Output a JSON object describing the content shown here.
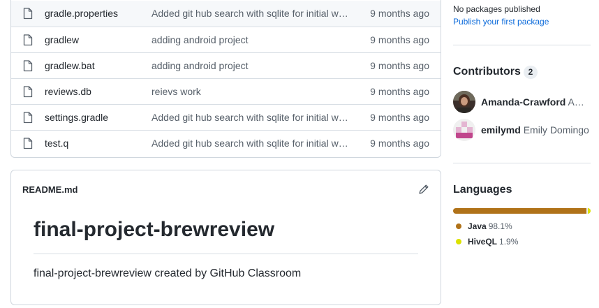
{
  "files": [
    {
      "name": "gradle.properties",
      "message": "Added git hub search with sqlite for initial work",
      "age": "9 months ago"
    },
    {
      "name": "gradlew",
      "message": "adding android project",
      "age": "9 months ago"
    },
    {
      "name": "gradlew.bat",
      "message": "adding android project",
      "age": "9 months ago"
    },
    {
      "name": "reviews.db",
      "message": "reievs work",
      "age": "9 months ago"
    },
    {
      "name": "settings.gradle",
      "message": "Added git hub search with sqlite for initial work",
      "age": "9 months ago"
    },
    {
      "name": "test.q",
      "message": "Added git hub search with sqlite for initial work",
      "age": "9 months ago"
    }
  ],
  "readme": {
    "filename": "README.md",
    "heading": "final-project-brewreview",
    "body": "final-project-brewreview created by GitHub Classroom"
  },
  "packages": {
    "none_text": "No packages published",
    "link_text": "Publish your first package"
  },
  "contributors": {
    "title": "Contributors",
    "count": "2",
    "items": [
      {
        "login": "Amanda-Crawford",
        "name": "Amanda Crawford"
      },
      {
        "login": "emilymd",
        "name": "Emily Domingo"
      }
    ]
  },
  "languages": {
    "title": "Languages",
    "items": [
      {
        "name": "Java",
        "percent": "98.1%",
        "share": 98.1,
        "color": "#b07219"
      },
      {
        "name": "HiveQL",
        "percent": "1.9%",
        "share": 1.9,
        "color": "#dce200"
      }
    ]
  },
  "icons": {
    "file": "file-icon",
    "edit": "pencil-icon"
  }
}
